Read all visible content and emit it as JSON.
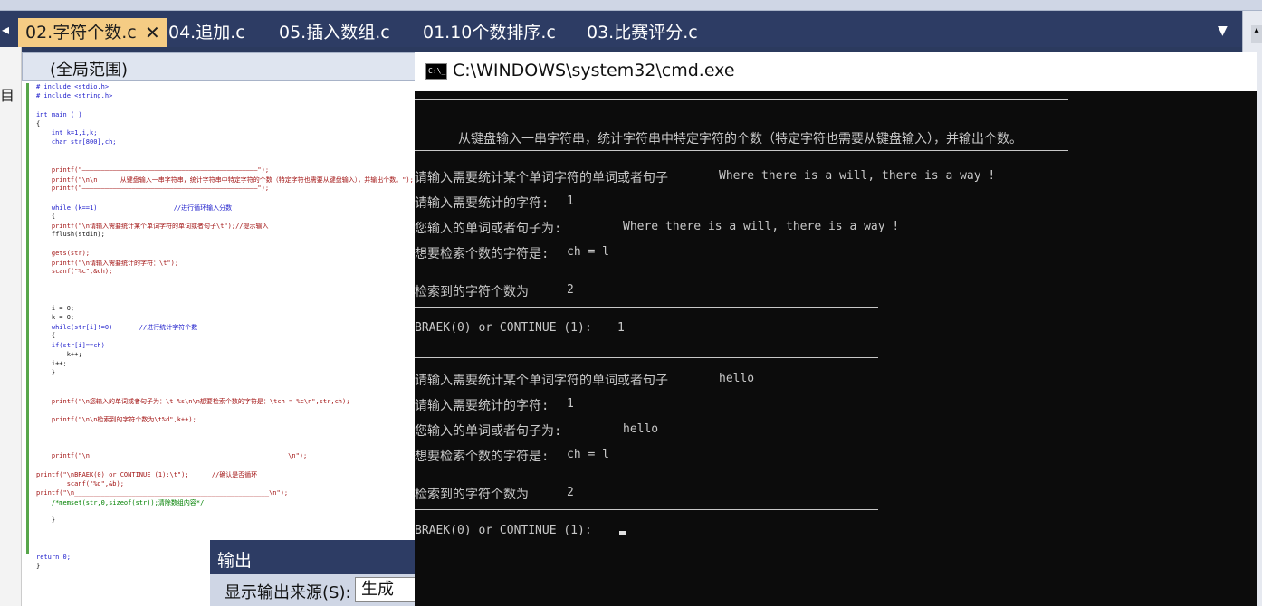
{
  "ide": {
    "tabs": [
      {
        "label": "02.字符个数.c",
        "active": true
      },
      {
        "label": "04.追加.c"
      },
      {
        "label": "05.插入数组.c"
      },
      {
        "label": "01.10个数排序.c"
      },
      {
        "label": "03.比赛评分.c"
      }
    ],
    "tab_close": "✕",
    "tab_scroll_left": "◂",
    "tab_dropdown": "▼",
    "scope": "(全局范围)",
    "left_glyph": "目",
    "output": {
      "title": "输出",
      "source_label": "显示输出来源(S):",
      "source_value": "生成"
    },
    "accent": "#f5cc84",
    "chrome": "#2d3c64"
  },
  "code": [
    "# include <stdio.h>",
    "# include <string.h>",
    "",
    "int main ( )",
    "{",
    "    int k=1,i,k;",
    "    char str[800],ch;",
    "",
    "",
    "    printf(\"——————————————————————————————————————————————\");",
    "    printf(\"\\n\\n      从键盘输入一串字符串，统计字符串中特定字符的个数（特定字符也需要从键盘输入），并输出个数。\");",
    "    printf(\"——————————————————————————————————————————————\");",
    "",
    "    while (k==1)                    //进行循环输入分数",
    "    {",
    "    printf(\"\\n请输入需要统计某个单词字符的单词或者句子\\t\");//提示输入",
    "    fflush(stdin);",
    "",
    "    gets(str);",
    "    printf(\"\\n请输入需要统计的字符：\\t\");",
    "    scanf(\"%c\",&ch);",
    "",
    "",
    "",
    "    i = 0;",
    "    k = 0;",
    "    while(str[i]!=0)       //进行统计字符个数",
    "    {",
    "    if(str[i]==ch)",
    "        k++;",
    "    i++;",
    "    }",
    "",
    "",
    "    printf(\"\\n您输入的单词或者句子为：\\t %s\\n\\n想要检索个数的字符是：\\tch = %c\\n\",str,ch);",
    "",
    "    printf(\"\\n\\n检索到的字符个数为\\t%d\",k++);",
    "",
    "",
    "",
    "    printf(\"\\n____________________________________________________\\n\");",
    "",
    "printf(\"\\nBRAEK(0) or CONTINUE (1):\\t\");      //确认是否循环",
    "        scanf(\"%d\",&b);",
    "printf(\"\\n___________________________________________________\\n\");",
    "    /*memset(str,0,sizeof(str));清除数组内容*/",
    "",
    "    }",
    "",
    "",
    "",
    "return 0;",
    "}"
  ],
  "console": {
    "title": "C:\\WINDOWS\\system32\\cmd.exe",
    "icon_text": "C:\\_",
    "intro": "从键盘输入一串字符串，统计字符串中特定字符的个数（特定字符也需要从键盘输入），并输出个数。",
    "prompt_sentence": "请输入需要统计某个单词字符的单词或者句子",
    "prompt_char": "请输入需要统计的字符:",
    "echo_sentence": "您输入的单词或者句子为:",
    "echo_char": "想要检索个数的字符是:",
    "count_label": "检索到的字符个数为",
    "continue_prompt": "BRAEK(0) or CONTINUE (1):",
    "round1": {
      "sentence": "Where there is a will, there is a way !",
      "char": "1",
      "char_echo": "ch = l",
      "count": "2",
      "continue": "1"
    },
    "round2": {
      "sentence": "hello",
      "char": "1",
      "char_echo": "ch = l",
      "count": "2"
    }
  }
}
